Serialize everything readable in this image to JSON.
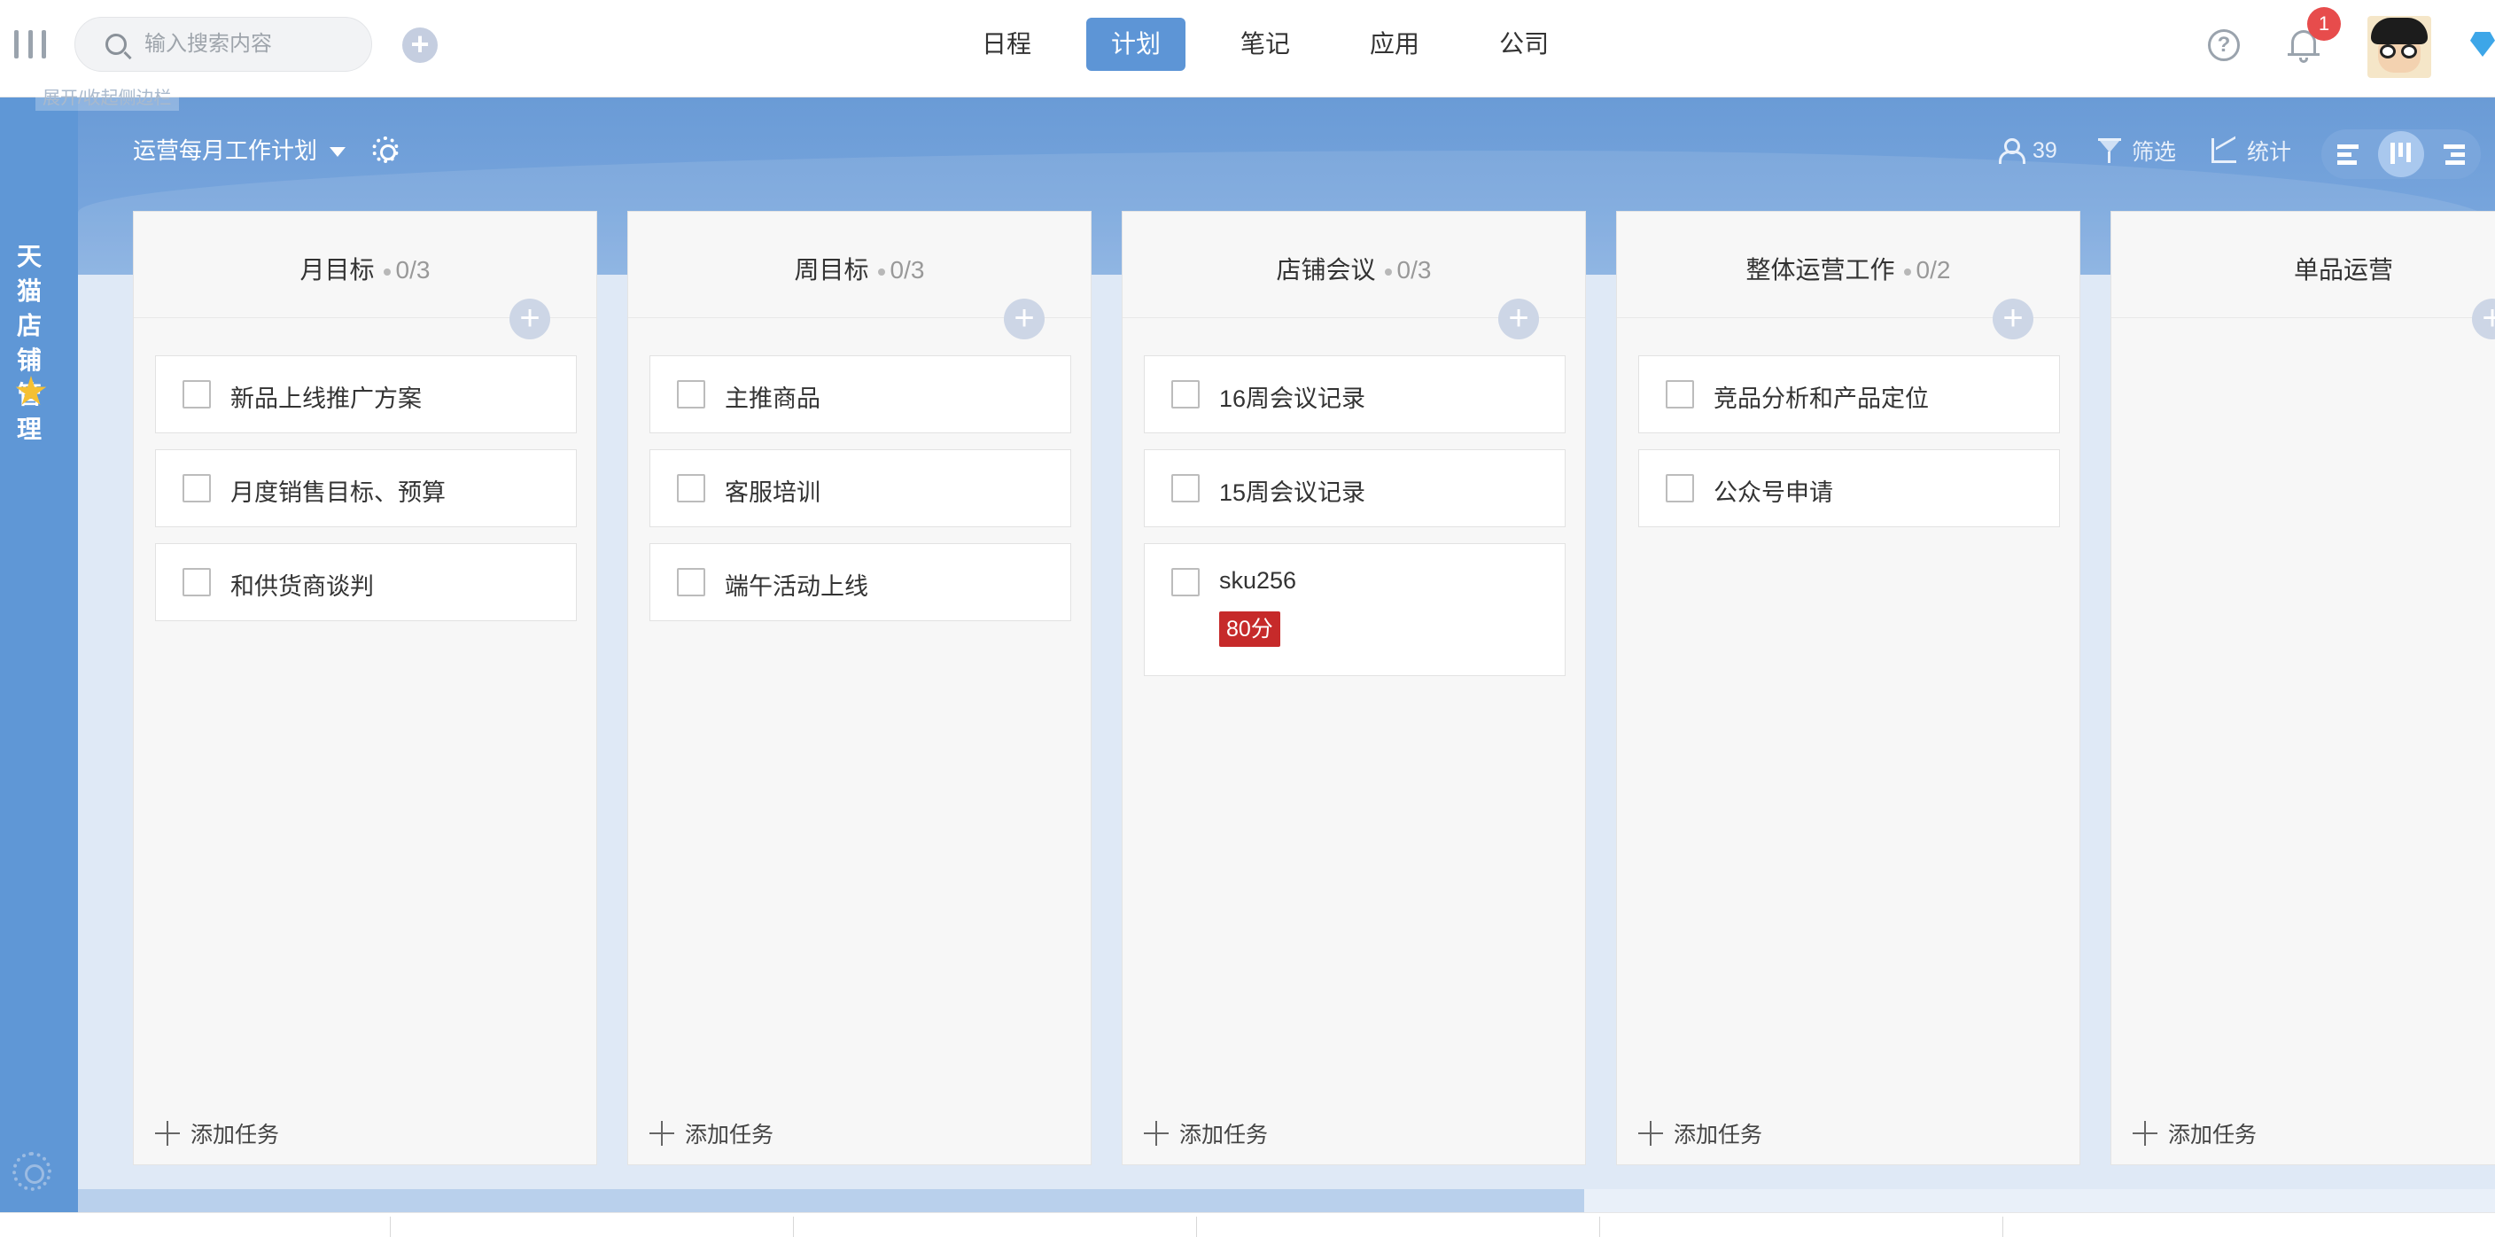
{
  "topbar": {
    "search_placeholder": "输入搜索内容",
    "nav": [
      "日程",
      "计划",
      "笔记",
      "应用",
      "公司"
    ],
    "active_nav": "计划",
    "notification_count": "1",
    "accent_color": "#5d95d6"
  },
  "sidebar": {
    "tooltip": "展开/收起侧边栏",
    "project_name": "天猫店铺管理",
    "icons": [
      "menu-icon",
      "star-icon",
      "gear-icon"
    ]
  },
  "board": {
    "title": "运营每月工作计划",
    "member_count": "39",
    "filter_label": "筛选",
    "stats_label": "统计",
    "add_task_label": "添加任务",
    "columns": [
      {
        "title": "月目标",
        "count": "0/3",
        "tasks": [
          {
            "text": "新品上线推广方案"
          },
          {
            "text": "月度销售目标、预算"
          },
          {
            "text": "和供货商谈判"
          }
        ]
      },
      {
        "title": "周目标",
        "count": "0/3",
        "tasks": [
          {
            "text": "主推商品"
          },
          {
            "text": "客服培训"
          },
          {
            "text": "端午活动上线"
          }
        ]
      },
      {
        "title": "店铺会议",
        "count": "0/3",
        "tasks": [
          {
            "text": "16周会议记录"
          },
          {
            "text": "15周会议记录"
          },
          {
            "text": "sku256",
            "score": "80分"
          }
        ]
      },
      {
        "title": "整体运营工作",
        "count": "0/2",
        "tasks": [
          {
            "text": "竞品分析和产品定位"
          },
          {
            "text": "公众号申请"
          }
        ]
      },
      {
        "title": "单品运营",
        "count": "",
        "tasks": []
      }
    ]
  }
}
